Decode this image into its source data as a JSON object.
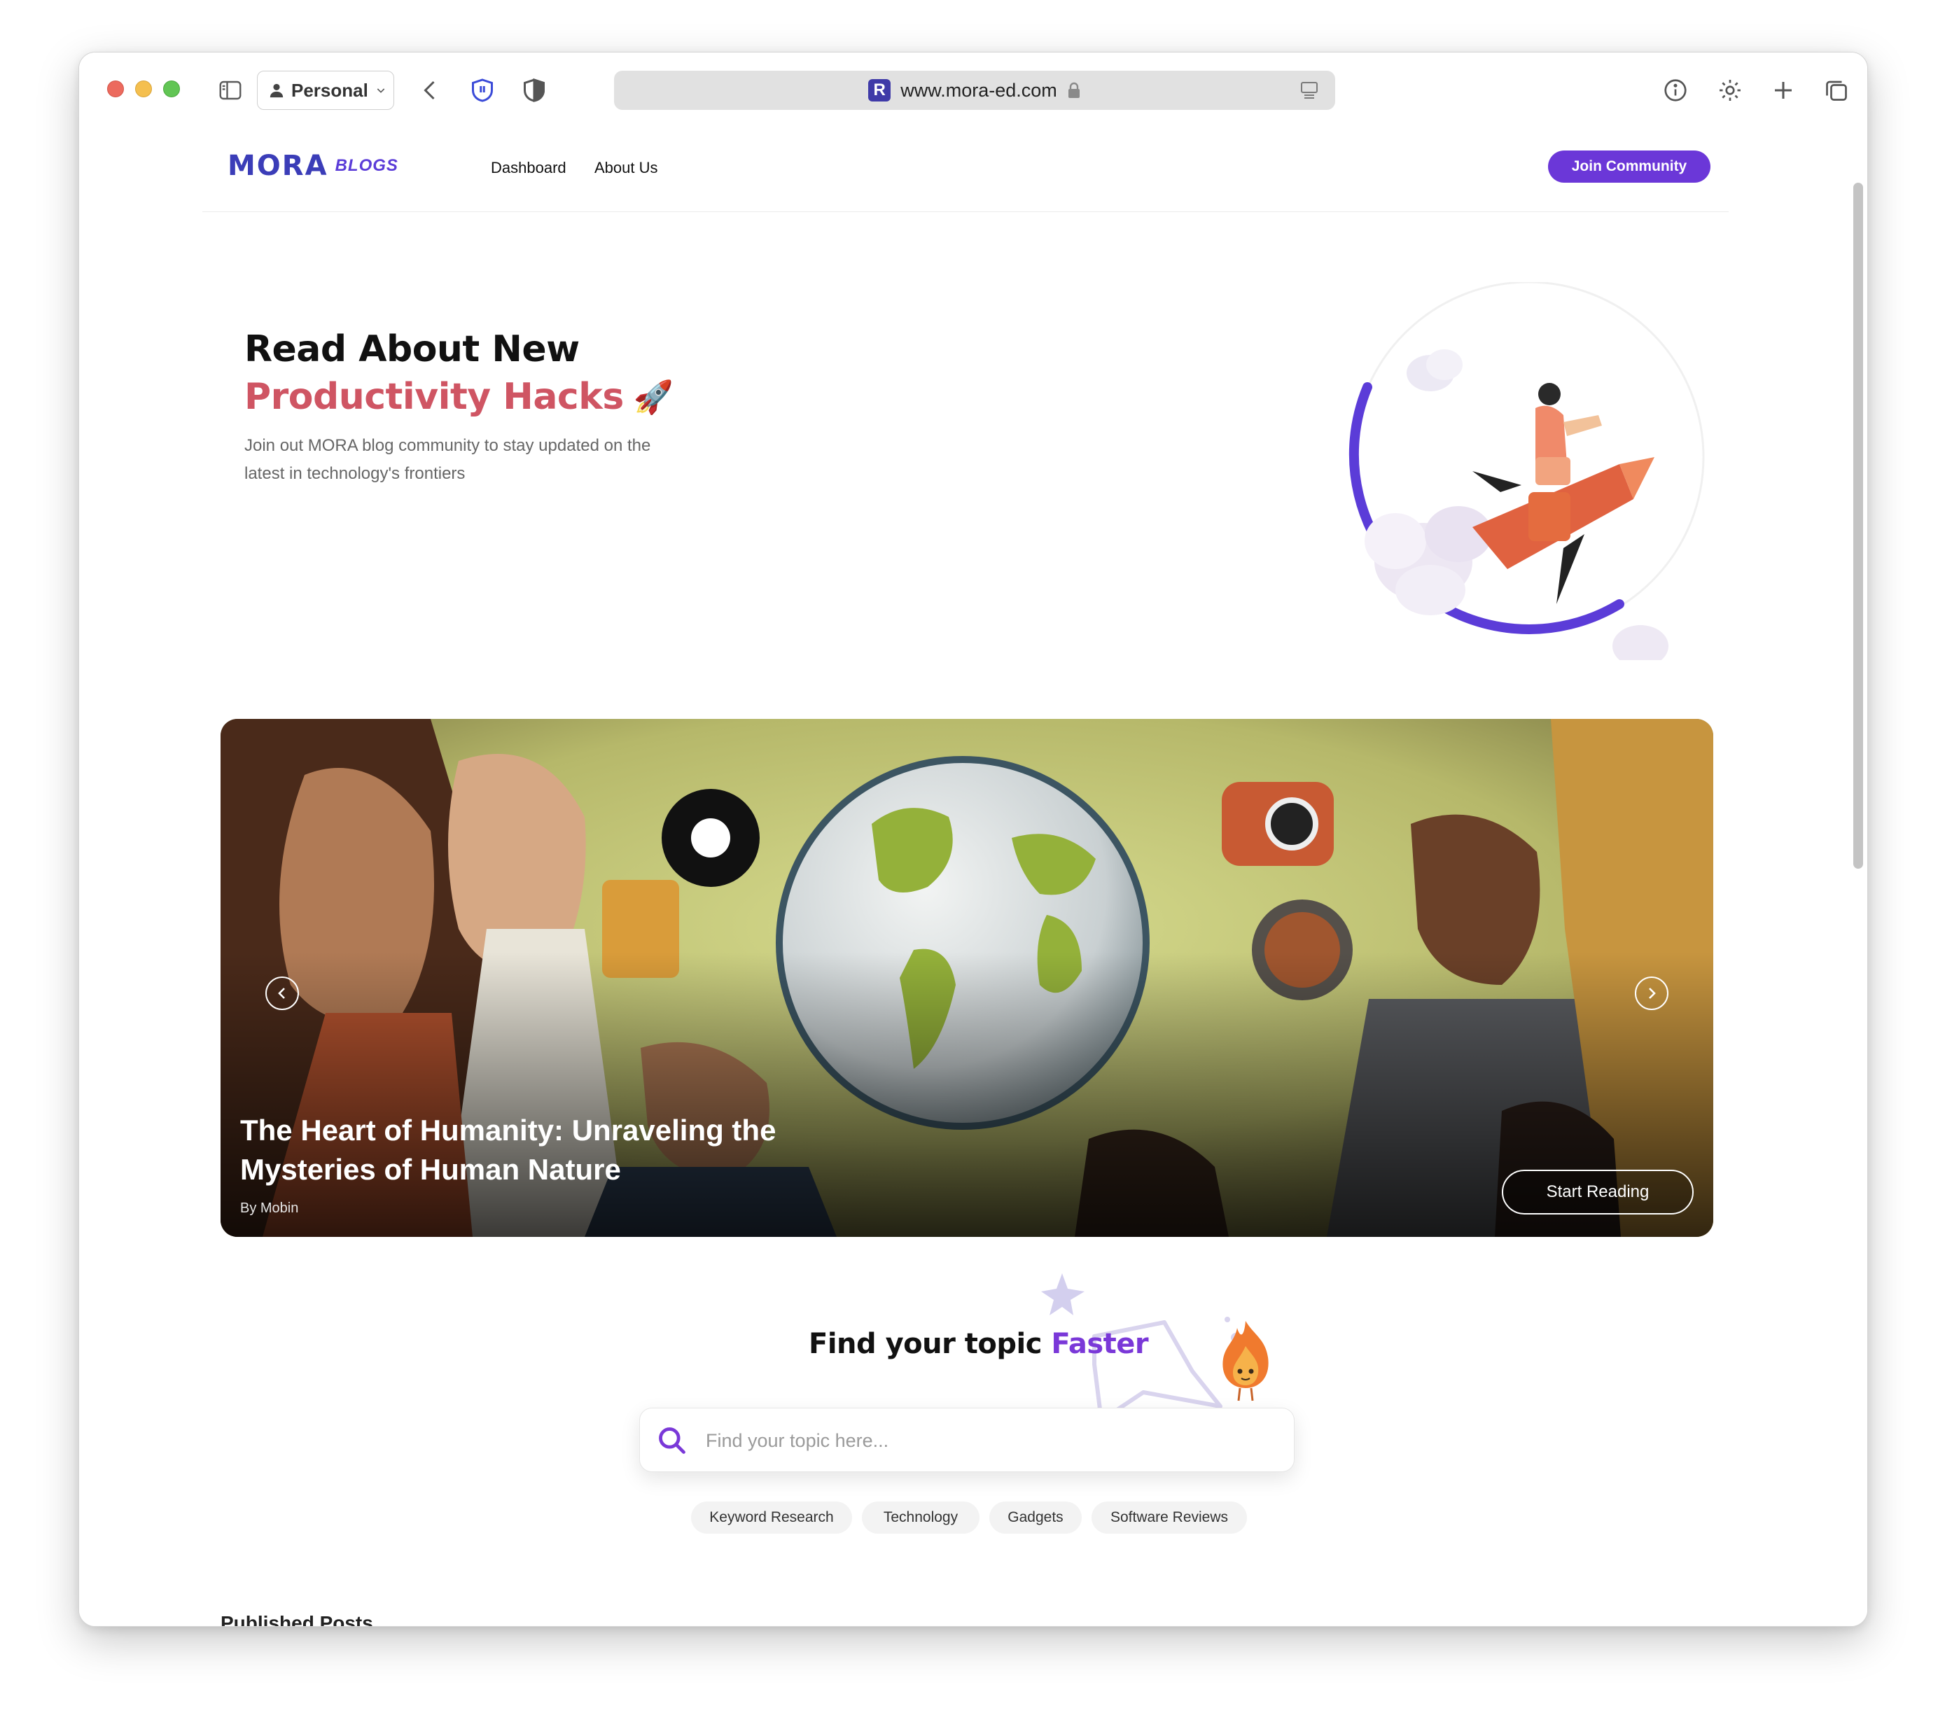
{
  "browser": {
    "profile_label": "Personal",
    "url": "www.mora-ed.com"
  },
  "site": {
    "logo_text": "MORA",
    "logo_suffix": "BLOGS",
    "nav": [
      "Dashboard",
      "About Us"
    ],
    "join_label": "Join Community"
  },
  "hero": {
    "title_line1": "Read About New",
    "title_line2": "Productivity Hacks",
    "title_emoji": "🚀",
    "subtitle": "Join out MORA blog community to stay updated on the latest in technology's frontiers"
  },
  "carousel": {
    "title": "The Heart of Humanity: Unraveling the Mysteries of Human Nature",
    "author": "By Mobin",
    "cta": "Start Reading"
  },
  "search": {
    "title_main": "Find your topic",
    "title_accent": "Faster",
    "placeholder": "Find your topic here...",
    "chips": [
      "Keyword Research",
      "Technology",
      "Gadgets",
      "Software Reviews"
    ]
  },
  "published_label": "Published Posts",
  "colors": {
    "brand": "#6b37d8",
    "hero_accent": "#cf5563",
    "search_accent": "#7a38d8"
  }
}
